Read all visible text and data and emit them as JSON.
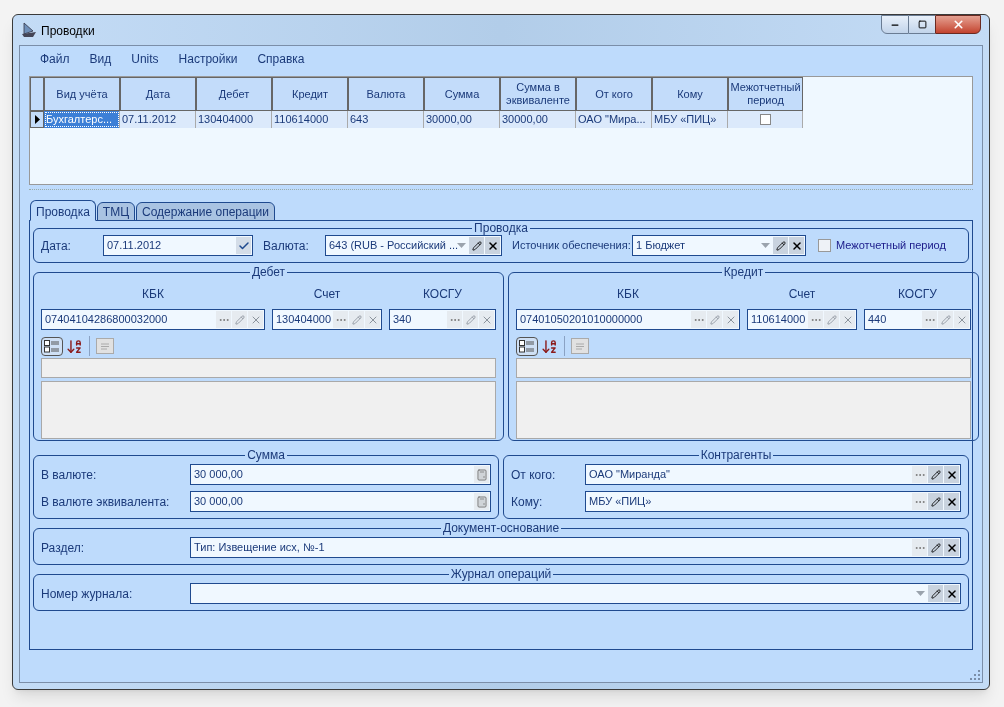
{
  "window": {
    "title": "Проводки"
  },
  "menu": [
    "Файл",
    "Вид",
    "Units",
    "Настройки",
    "Справка"
  ],
  "grid": {
    "columns": [
      "Вид учёта",
      "Дата",
      "Дебет",
      "Кредит",
      "Валюта",
      "Сумма",
      "Сумма в эквиваленте",
      "От кого",
      "Кому",
      "Межотчетный период"
    ],
    "rows": [
      {
        "selected": true,
        "cells": [
          "Бухгалтерс...",
          "07.11.2012",
          "130404000",
          "110614000",
          "643",
          "30000,00",
          "30000,00",
          "ОАО \"Мира...",
          "МБУ «ПИЦ»"
        ],
        "interperiod": false
      }
    ]
  },
  "tabs": [
    {
      "label": "Проводка",
      "selected": true
    },
    {
      "label": "ТМЦ",
      "selected": false
    },
    {
      "label": "Содержание операции",
      "selected": false
    }
  ],
  "posting": {
    "title": "Проводка",
    "date": {
      "label": "Дата:",
      "value": "07.11.2012",
      "kind": "date",
      "actions_enabled": true
    },
    "currency": {
      "label": "Валюта:",
      "value": "643 (RUB - Российский ...",
      "kind": "dropdown",
      "actions_enabled": true
    },
    "source": {
      "label": "Источник обеспечения:",
      "value": "1 Бюджет",
      "kind": "dropdown",
      "actions_enabled": true
    },
    "interperiod": {
      "label": "Межотчетный период",
      "checked": false
    }
  },
  "accounts": [
    {
      "title": "Дебет",
      "columns": [
        {
          "label": "КБК",
          "value": "07404104286800032000",
          "kind": "lookup",
          "actions_enabled": false
        },
        {
          "label": "Счет",
          "value": "130404000",
          "kind": "lookup",
          "actions_enabled": false
        },
        {
          "label": "КОСГУ",
          "value": "340",
          "kind": "lookup",
          "actions_enabled": false
        }
      ]
    },
    {
      "title": "Кредит",
      "columns": [
        {
          "label": "КБК",
          "value": "07401050201010000000",
          "kind": "lookup",
          "actions_enabled": false
        },
        {
          "label": "Счет",
          "value": "110614000",
          "kind": "lookup",
          "actions_enabled": false
        },
        {
          "label": "КОСГУ",
          "value": "440",
          "kind": "lookup",
          "actions_enabled": false
        }
      ]
    }
  ],
  "sums": {
    "title": "Сумма",
    "rows": [
      {
        "label": "В валюте:",
        "value": "30 000,00",
        "kind": "calc",
        "actions_enabled": true
      },
      {
        "label": "В валюте эквивалента:",
        "value": "30 000,00",
        "kind": "calc",
        "actions_enabled": true
      }
    ]
  },
  "counterparties": {
    "title": "Контрагенты",
    "rows": [
      {
        "label": "От кого:",
        "value": "ОАО \"Миранда\"",
        "kind": "lookup",
        "actions_enabled": true
      },
      {
        "label": "Кому:",
        "value": "МБУ «ПИЦ»",
        "kind": "lookup",
        "actions_enabled": true
      }
    ]
  },
  "basis": {
    "title": "Документ-основание",
    "rows": [
      {
        "label": "Раздел:",
        "value": "Тип: Извещение исх, №-1",
        "kind": "lookup",
        "actions_enabled": true
      }
    ]
  },
  "journal": {
    "title": "Журнал операций",
    "rows": [
      {
        "label": "Номер журнала:",
        "kind": "dropdown",
        "actions_enabled": true
      }
    ]
  }
}
